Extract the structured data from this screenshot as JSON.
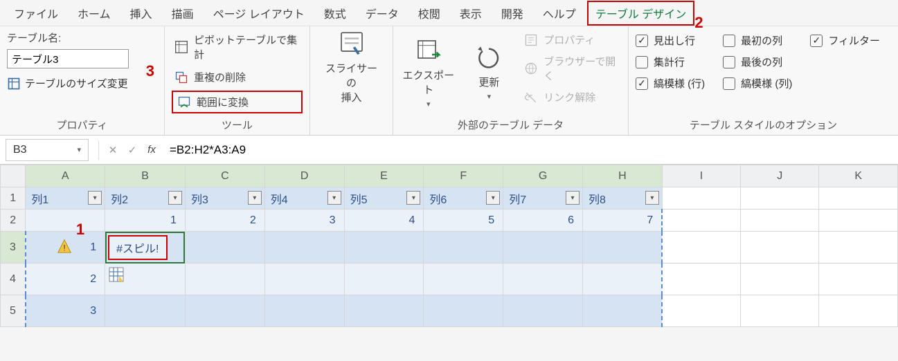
{
  "menu": {
    "items": [
      "ファイル",
      "ホーム",
      "挿入",
      "描画",
      "ページ レイアウト",
      "数式",
      "データ",
      "校閲",
      "表示",
      "開発",
      "ヘルプ",
      "テーブル デザイン"
    ],
    "active_index": 11
  },
  "ribbon": {
    "properties": {
      "table_name_label": "テーブル名:",
      "table_name_value": "テーブル3",
      "resize_label": "テーブルのサイズ変更",
      "group_label": "プロパティ"
    },
    "tools": {
      "pivot_label": "ピボットテーブルで集計",
      "dedup_label": "重複の削除",
      "convert_label": "範囲に変換",
      "group_label": "ツール"
    },
    "slicer": {
      "label_line1": "スライサーの",
      "label_line2": "挿入"
    },
    "external": {
      "export_label": "エクスポート",
      "refresh_label": "更新",
      "props_label": "プロパティ",
      "open_browser_label": "ブラウザーで開く",
      "unlink_label": "リンク解除",
      "group_label": "外部のテーブル データ"
    },
    "style_opts": {
      "header_row": {
        "label": "見出し行",
        "checked": true
      },
      "total_row": {
        "label": "集計行",
        "checked": false
      },
      "banded_rows": {
        "label": "縞模様 (行)",
        "checked": true
      },
      "first_col": {
        "label": "最初の列",
        "checked": false
      },
      "last_col": {
        "label": "最後の列",
        "checked": false
      },
      "banded_cols": {
        "label": "縞模様 (列)",
        "checked": false
      },
      "filter_btn": {
        "label": "フィルター",
        "checked": true
      },
      "group_label": "テーブル スタイルのオプション"
    }
  },
  "formula_bar": {
    "name_box": "B3",
    "formula": "=B2:H2*A3:A9"
  },
  "columns": [
    "A",
    "B",
    "C",
    "D",
    "E",
    "F",
    "G",
    "H",
    "I",
    "J",
    "K"
  ],
  "table": {
    "headers": [
      "列1",
      "列2",
      "列3",
      "列4",
      "列5",
      "列6",
      "列7",
      "列8"
    ],
    "row2_values": [
      "",
      "1",
      "2",
      "3",
      "4",
      "5",
      "6",
      "7"
    ],
    "row3_A": "1",
    "row3_B": "#スピル!",
    "row4_A": "2",
    "row5_A": "3"
  },
  "annotations": {
    "a1": "1",
    "a2": "2",
    "a3": "3"
  }
}
